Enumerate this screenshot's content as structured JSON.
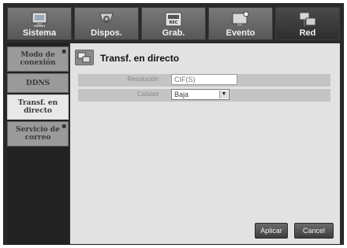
{
  "tabs": [
    {
      "label": "Sistema",
      "icon": "monitor-icon"
    },
    {
      "label": "Dispos.",
      "icon": "camera-icon"
    },
    {
      "label": "Grab.",
      "icon": "recorder-icon"
    },
    {
      "label": "Evento",
      "icon": "event-monitor-icon"
    },
    {
      "label": "Red",
      "icon": "network-icon",
      "active": true
    }
  ],
  "sidebar": {
    "items": [
      {
        "label": "Modo de conexión"
      },
      {
        "label": "DDNS"
      },
      {
        "label": "Transf. en directo",
        "active": true
      },
      {
        "label": "Servicio de correo"
      }
    ]
  },
  "panel": {
    "title": "Transf. en directo",
    "icon": "network-icon",
    "fields": {
      "resolution_label": "Resolución",
      "resolution_value": "CIF(S)",
      "quality_label": "Calidad",
      "quality_value": "Baja"
    }
  },
  "buttons": {
    "apply": "Aplicar",
    "cancel": "Cancel"
  }
}
